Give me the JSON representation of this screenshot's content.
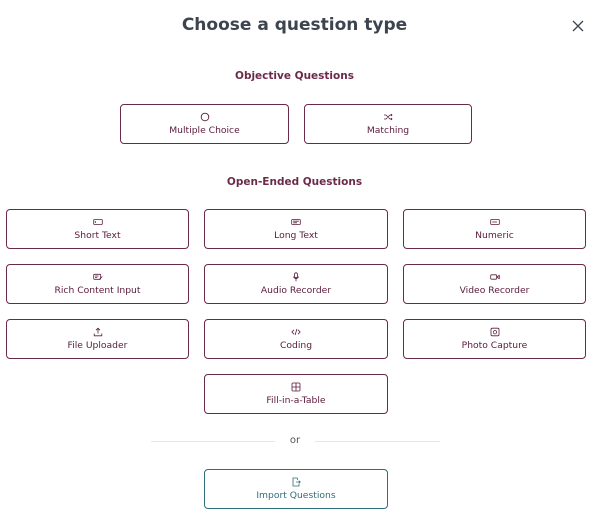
{
  "modal": {
    "title": "Choose a question type",
    "close_icon": "close-icon"
  },
  "objective": {
    "heading": "Objective Questions",
    "items": [
      {
        "label": "Multiple Choice",
        "icon": "radio-circle-icon"
      },
      {
        "label": "Matching",
        "icon": "shuffle-icon"
      }
    ]
  },
  "open_ended": {
    "heading": "Open-Ended Questions",
    "items": [
      {
        "label": "Short Text",
        "icon": "short-text-icon"
      },
      {
        "label": "Long Text",
        "icon": "long-text-icon"
      },
      {
        "label": "Numeric",
        "icon": "numeric-icon"
      },
      {
        "label": "Rich Content Input",
        "icon": "rich-content-icon"
      },
      {
        "label": "Audio Recorder",
        "icon": "microphone-icon"
      },
      {
        "label": "Video Recorder",
        "icon": "video-camera-icon"
      },
      {
        "label": "File Uploader",
        "icon": "upload-icon"
      },
      {
        "label": "Coding",
        "icon": "code-icon"
      },
      {
        "label": "Photo Capture",
        "icon": "camera-icon"
      },
      {
        "label": "Fill-in-a-Table",
        "icon": "table-icon"
      }
    ]
  },
  "divider": {
    "text": "or"
  },
  "import": {
    "label": "Import Questions",
    "icon": "import-file-icon"
  },
  "colors": {
    "primary": "#6b2a4a",
    "import": "#2f6f7a",
    "title": "#3d4450"
  }
}
